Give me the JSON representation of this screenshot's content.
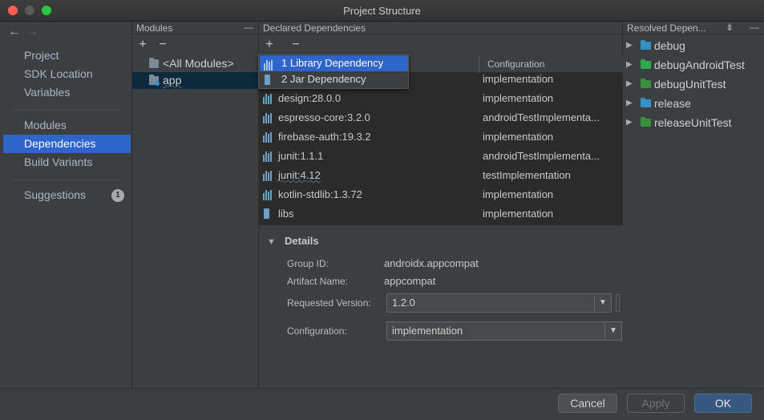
{
  "window": {
    "title": "Project Structure"
  },
  "nav": {
    "back_icon": "arrow-left-icon",
    "forward_icon": "arrow-right-icon",
    "items": [
      {
        "label": "Project"
      },
      {
        "label": "SDK Location"
      },
      {
        "label": "Variables"
      },
      {
        "label": "Modules"
      },
      {
        "label": "Dependencies"
      },
      {
        "label": "Build Variants"
      },
      {
        "label": "Suggestions",
        "badge": "1"
      }
    ],
    "selected": "Dependencies"
  },
  "modules": {
    "header": "Modules",
    "add": "+",
    "remove": "−",
    "items": [
      {
        "label": "<All Modules>"
      },
      {
        "label": "app"
      }
    ]
  },
  "dependencies": {
    "header": "Declared Dependencies",
    "add": "+",
    "remove": "−",
    "column_config": "Configuration",
    "add_menu": [
      {
        "label": "1  Library Dependency"
      },
      {
        "label": "2  Jar Dependency"
      }
    ],
    "rows": [
      {
        "name": "",
        "configuration": "implementation"
      },
      {
        "name": "design:28.0.0",
        "configuration": "implementation"
      },
      {
        "name": "espresso-core:3.2.0",
        "configuration": "androidTestImplementa..."
      },
      {
        "name": "firebase-auth:19.3.2",
        "configuration": "implementation"
      },
      {
        "name": "junit:1.1.1",
        "configuration": "androidTestImplementa..."
      },
      {
        "name": "junit:4.12",
        "configuration": "testImplementation"
      },
      {
        "name": "kotlin-stdlib:1.3.72",
        "configuration": "implementation"
      },
      {
        "name": "libs",
        "configuration": "implementation"
      }
    ]
  },
  "details": {
    "title": "Details",
    "group_id_label": "Group ID:",
    "group_id": "androidx.appcompat",
    "artifact_label": "Artifact Name:",
    "artifact": "appcompat",
    "version_label": "Requested Version:",
    "version": "1.2.0",
    "config_label": "Configuration:",
    "config": "implementation"
  },
  "resolved": {
    "header": "Resolved Depen...",
    "items": [
      {
        "label": "debug",
        "color": "#3592c4"
      },
      {
        "label": "debugAndroidTest",
        "color": "#2fa84f"
      },
      {
        "label": "debugUnitTest",
        "color": "#3a8f3e"
      },
      {
        "label": "release",
        "color": "#3592c4"
      },
      {
        "label": "releaseUnitTest",
        "color": "#3a8f3e"
      }
    ]
  },
  "buttons": {
    "cancel": "Cancel",
    "apply": "Apply",
    "ok": "OK"
  }
}
